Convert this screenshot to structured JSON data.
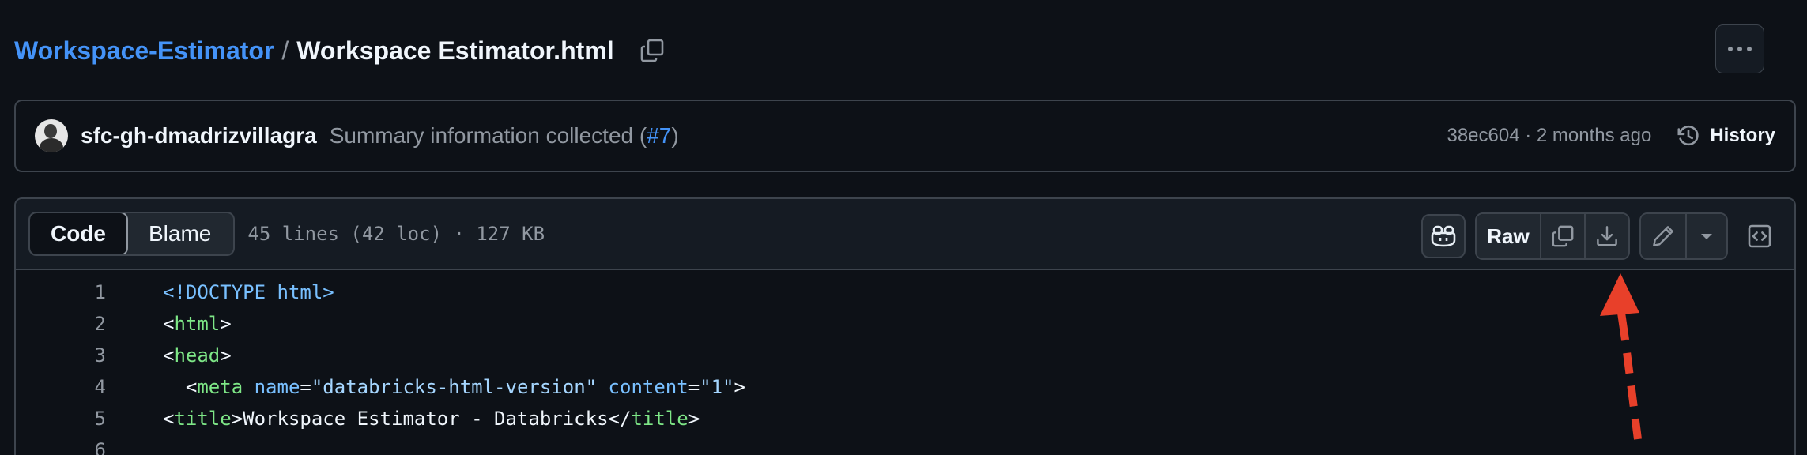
{
  "breadcrumb": {
    "repo": "Workspace-Estimator",
    "separator": "/",
    "file": "Workspace Estimator.html"
  },
  "commit": {
    "author": "sfc-gh-dmadrizvillagra",
    "message_prefix": "Summary information collected (",
    "pr": "#7",
    "message_suffix": ")",
    "meta": "38ec604 · 2 months ago",
    "history_label": "History"
  },
  "file_header": {
    "tabs": [
      "Code",
      "Blame"
    ],
    "info": "45 lines (42 loc) · 127 KB",
    "raw_label": "Raw"
  },
  "code_lines": [
    {
      "num": "1",
      "parts": [
        {
          "cls": "t-doctype",
          "text": "<!DOCTYPE html>"
        }
      ]
    },
    {
      "num": "2",
      "parts": [
        {
          "cls": "",
          "text": "<"
        },
        {
          "cls": "t-tag",
          "text": "html"
        },
        {
          "cls": "",
          "text": ">"
        }
      ]
    },
    {
      "num": "3",
      "parts": [
        {
          "cls": "",
          "text": "<"
        },
        {
          "cls": "t-tag",
          "text": "head"
        },
        {
          "cls": "",
          "text": ">"
        }
      ]
    },
    {
      "num": "4",
      "parts": [
        {
          "cls": "",
          "text": "  <"
        },
        {
          "cls": "t-tag",
          "text": "meta"
        },
        {
          "cls": "",
          "text": " "
        },
        {
          "cls": "t-attr",
          "text": "name"
        },
        {
          "cls": "",
          "text": "="
        },
        {
          "cls": "t-str",
          "text": "\"databricks-html-version\""
        },
        {
          "cls": "",
          "text": " "
        },
        {
          "cls": "t-attr",
          "text": "content"
        },
        {
          "cls": "",
          "text": "="
        },
        {
          "cls": "t-str",
          "text": "\"1\""
        },
        {
          "cls": "",
          "text": ">"
        }
      ]
    },
    {
      "num": "5",
      "parts": [
        {
          "cls": "",
          "text": "<"
        },
        {
          "cls": "t-tag",
          "text": "title"
        },
        {
          "cls": "",
          "text": ">Workspace Estimator - Databricks</"
        },
        {
          "cls": "t-tag",
          "text": "title"
        },
        {
          "cls": "",
          "text": ">"
        }
      ]
    },
    {
      "num": "6",
      "parts": []
    }
  ],
  "icons": {
    "copy_path": "copy-icon",
    "more": "kebab-horizontal-icon",
    "history": "history-icon",
    "copilot": "copilot-icon",
    "copy_raw": "copy-icon",
    "download": "download-icon",
    "edit": "pencil-icon",
    "edit_menu": "triangle-down-icon",
    "symbols": "code-square-icon"
  },
  "colors": {
    "background": "#0d1117",
    "link": "#4493f8",
    "border": "#3d444d",
    "annotation_arrow": "#e8402a"
  }
}
